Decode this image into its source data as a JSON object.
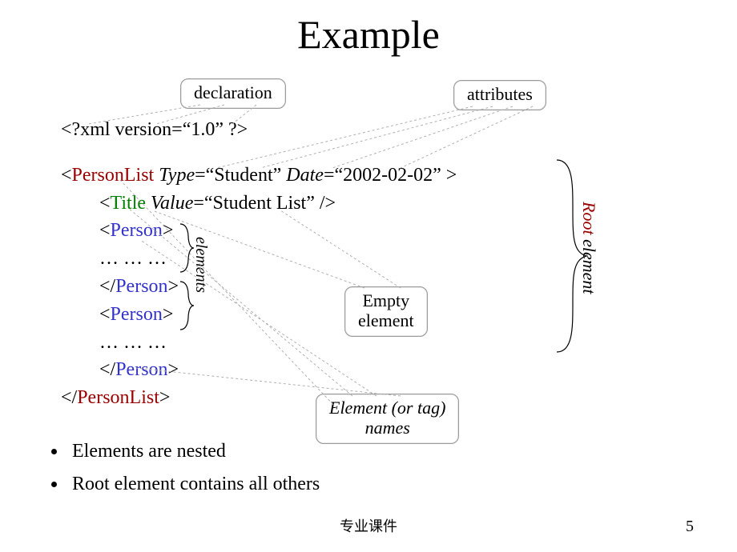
{
  "title": "Example",
  "callouts": {
    "declaration": "declaration",
    "attributes": "attributes",
    "empty_l1": "Empty",
    "empty_l2": "element",
    "names_l1": "Element (or tag)",
    "names_l2": "names"
  },
  "code": {
    "xml_open": "<?xml  version=“1.0” ?>",
    "pl_open_lt": "<",
    "pl_name": "PersonList",
    "pl_attr_type_name": "Type",
    "pl_attr_type_eq_val": "=“Student”  ",
    "pl_attr_date_name": "Date",
    "pl_attr_date_eq_val": "=“2002-02-02” >",
    "title_open_lt": "<",
    "title_name": "Title",
    "title_attr_value_name": "  Value",
    "title_attr_value_eq": "=“Student List” />",
    "person_open_lt": "<",
    "person_name": "Person",
    "person_open_gt": ">",
    "ellipsis": "… … …",
    "person_close_lt": "</",
    "person_close_gt": ">",
    "pl_close_lt": "</",
    "pl_close_gt": ">"
  },
  "labels": {
    "elements": "elements",
    "root_word": "Root",
    "root_rest": " element"
  },
  "bullets": [
    "Elements are nested",
    "Root element contains all others"
  ],
  "footer": "专业课件",
  "page": "5"
}
